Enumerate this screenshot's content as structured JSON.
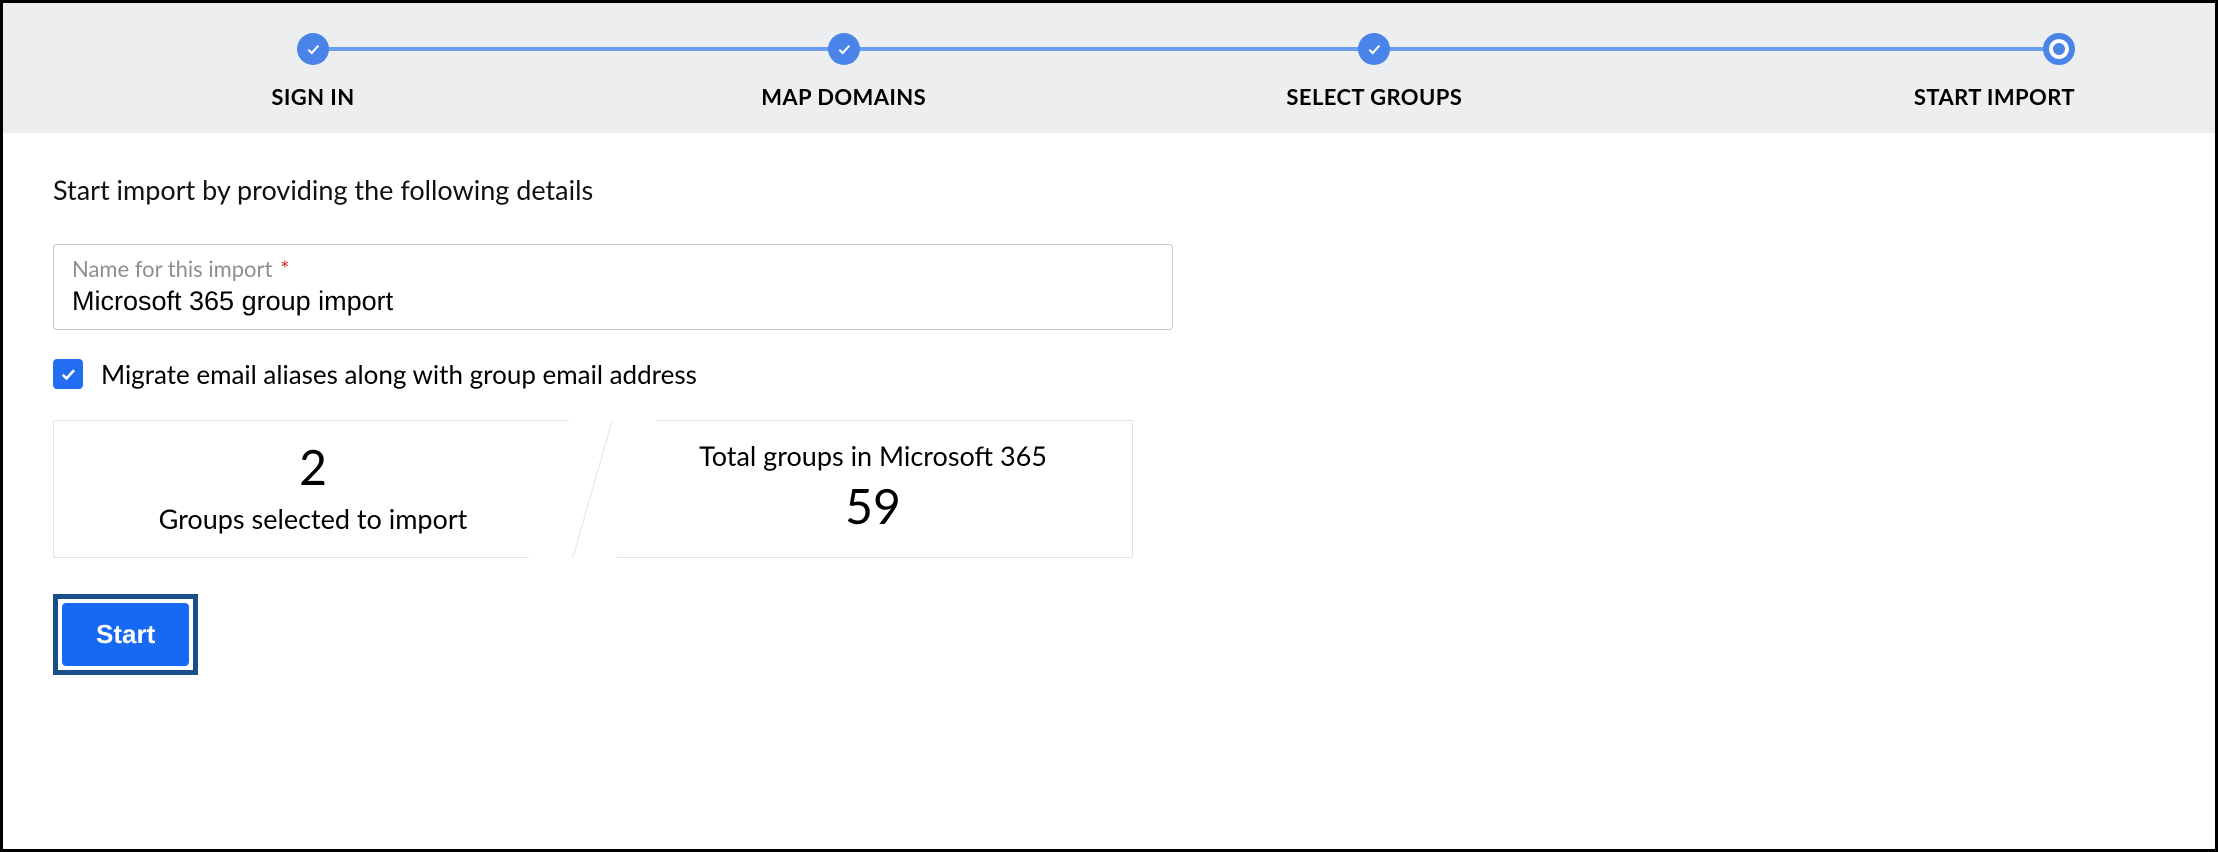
{
  "stepper": {
    "steps": [
      {
        "label": "SIGN IN",
        "state": "done"
      },
      {
        "label": "MAP DOMAINS",
        "state": "done"
      },
      {
        "label": "SELECT GROUPS",
        "state": "done"
      },
      {
        "label": "START IMPORT",
        "state": "current"
      }
    ]
  },
  "intro_text": "Start import by providing the following details",
  "field": {
    "label": "Name for this import",
    "required_mark": "*",
    "value": "Microsoft 365 group import"
  },
  "checkbox": {
    "checked": true,
    "label": "Migrate email aliases along with group email address"
  },
  "stats": {
    "selected": {
      "value": "2",
      "label": "Groups selected to import"
    },
    "total": {
      "value": "59",
      "label": "Total groups in Microsoft 365"
    }
  },
  "start_button": "Start"
}
